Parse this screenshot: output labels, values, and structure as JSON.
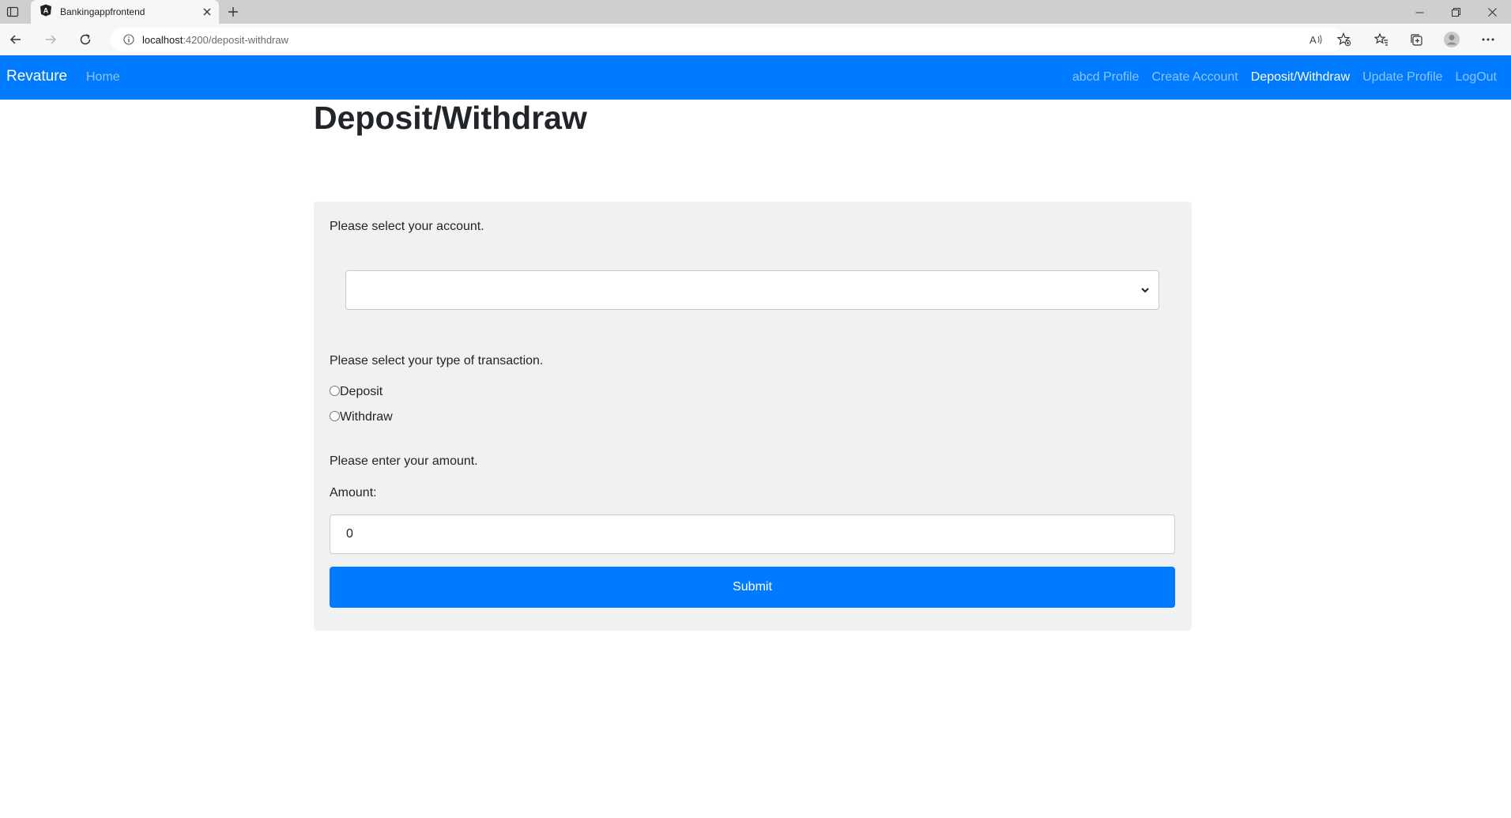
{
  "browser": {
    "tab_title": "Bankingappfrontend",
    "url_host": "localhost",
    "url_path": ":4200/deposit-withdraw",
    "icons": [
      "sidebar-icon",
      "angular-icon",
      "close-icon",
      "plus-icon",
      "minimize-icon",
      "restore-icon",
      "window-close-icon",
      "back-icon",
      "forward-icon",
      "refresh-icon",
      "info-icon",
      "read-aloud-icon",
      "favorite-add-icon",
      "favorites-icon",
      "collections-icon",
      "profile-icon",
      "more-icon"
    ]
  },
  "navbar": {
    "brand": "Revature",
    "home": "Home",
    "links": [
      "abcd Profile",
      "Create Account",
      "Deposit/Withdraw",
      "Update Profile",
      "LogOut"
    ],
    "active": "Deposit/Withdraw",
    "color": "#007bff"
  },
  "page": {
    "title": "Deposit/Withdraw",
    "account_prompt": "Please select your account.",
    "account_selected": "",
    "transaction_prompt": "Please select your type of transaction.",
    "options": [
      "Deposit",
      "Withdraw"
    ],
    "amount_prompt": "Please enter your amount.",
    "amount_label": "Amount:",
    "amount_value": "0",
    "submit_label": "Submit"
  }
}
